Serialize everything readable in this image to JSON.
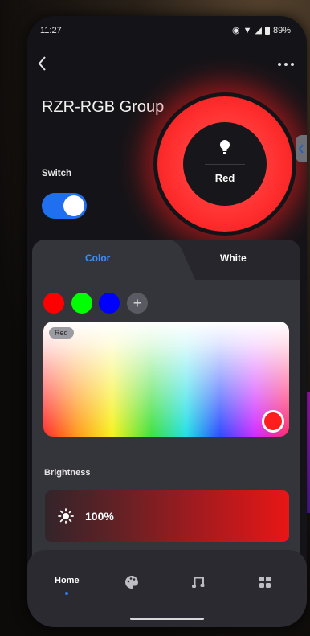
{
  "status_bar": {
    "time": "11:27",
    "battery": "89%"
  },
  "header": {
    "title": "RZR-RGB Group"
  },
  "switch": {
    "label": "Switch",
    "state": "on"
  },
  "color_ring": {
    "label": "Red",
    "color": "#ff2e2e"
  },
  "tabs": [
    {
      "label": "Color",
      "active": true
    },
    {
      "label": "White",
      "active": false
    }
  ],
  "swatches": [
    {
      "name": "red",
      "color": "#ff0000"
    },
    {
      "name": "green",
      "color": "#00ff00"
    },
    {
      "name": "blue",
      "color": "#0000ff"
    }
  ],
  "add_swatch": "+",
  "picker": {
    "chip_label": "Red"
  },
  "brightness": {
    "label": "Brightness",
    "value": "100%"
  },
  "nav": {
    "home_label": "Home",
    "items": [
      "palette-icon",
      "music-icon",
      "grid-icon"
    ]
  },
  "accent_color": "#2f7cf4"
}
